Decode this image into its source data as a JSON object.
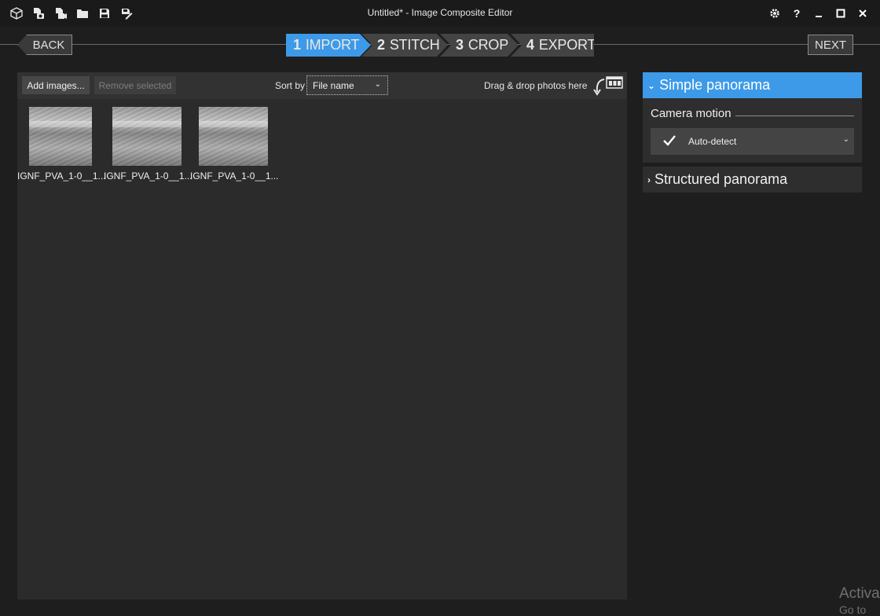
{
  "window": {
    "title": "Untitled* - Image Composite Editor",
    "icons": [
      "new-project-icon",
      "import-images-icon",
      "import-video-icon",
      "open-project-icon",
      "save-icon",
      "save-as-icon"
    ],
    "controls": [
      "settings-icon",
      "help-icon",
      "minimize-icon",
      "maximize-icon",
      "close-icon"
    ],
    "help_label": "?"
  },
  "nav": {
    "back": "BACK",
    "next": "NEXT",
    "steps": [
      {
        "num": "1",
        "label": "IMPORT",
        "active": true
      },
      {
        "num": "2",
        "label": "STITCH",
        "active": false
      },
      {
        "num": "3",
        "label": "CROP",
        "active": false
      },
      {
        "num": "4",
        "label": "EXPORT",
        "active": false
      }
    ]
  },
  "import": {
    "add_images": "Add images...",
    "remove_selected": "Remove selected",
    "sort_by_label": "Sort by",
    "sort_value": "File name",
    "drag_drop": "Drag & drop photos here",
    "thumbnails": [
      {
        "caption": "IGNF_PVA_1-0__1..."
      },
      {
        "caption": "IGNF_PVA_1-0__1..."
      },
      {
        "caption": "IGNF_PVA_1-0__1..."
      }
    ]
  },
  "side": {
    "simple_panorama": "Simple panorama",
    "camera_motion_label": "Camera motion",
    "camera_motion_value": "Auto-detect",
    "structured_panorama": "Structured panorama"
  },
  "watermark": {
    "line1": "Activa",
    "line2": "Go to"
  },
  "colors": {
    "accent": "#3d9ae8",
    "background": "#1e1e1e",
    "panel": "#2b2b2b"
  }
}
